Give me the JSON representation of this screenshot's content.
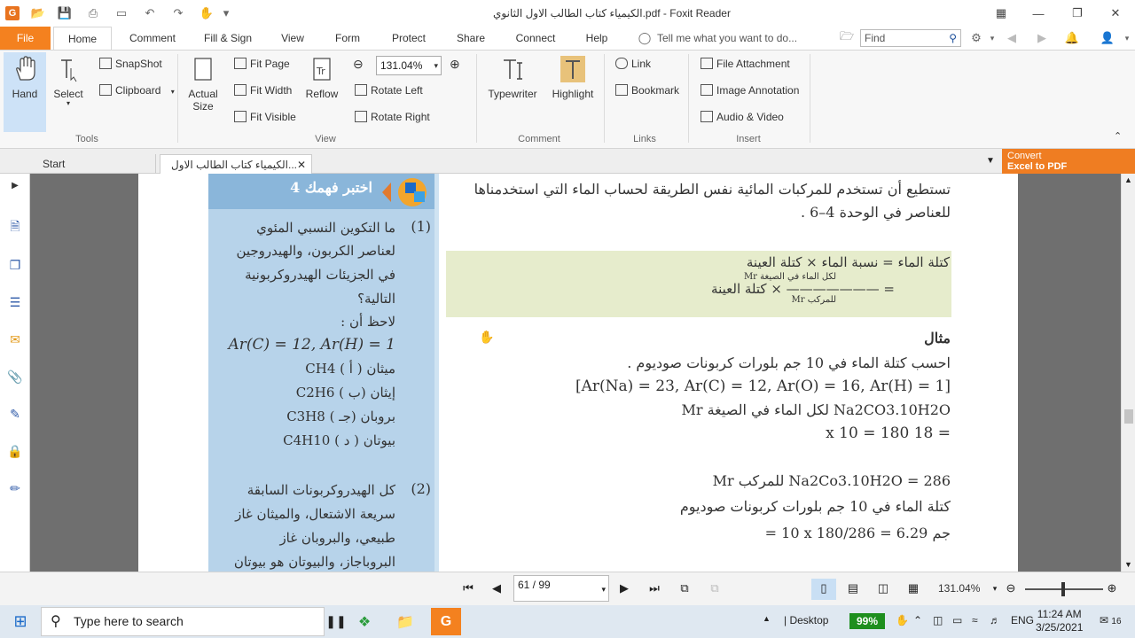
{
  "titlebar": {
    "title": "الكيمياء كتاب الطالب الاول الثانوي.pdf - Foxit Reader"
  },
  "tabs": {
    "file": "File",
    "items": [
      "Home",
      "Comment",
      "Fill & Sign",
      "View",
      "Form",
      "Protect",
      "Share",
      "Connect",
      "Help"
    ],
    "tell_me": "Tell me what you want to do...",
    "find_placeholder": "Find"
  },
  "ribbon": {
    "tools": {
      "hand": "Hand",
      "select": "Select",
      "snapshot": "SnapShot",
      "clipboard": "Clipboard",
      "group": "Tools"
    },
    "view": {
      "actual_size_1": "Actual",
      "actual_size_2": "Size",
      "fit_page": "Fit Page",
      "fit_width": "Fit Width",
      "fit_visible": "Fit Visible",
      "reflow": "Reflow",
      "zoom": "131.04%",
      "rotate_left": "Rotate Left",
      "rotate_right": "Rotate Right",
      "group": "View"
    },
    "comment": {
      "typewriter": "Typewriter",
      "highlight": "Highlight",
      "group": "Comment"
    },
    "links": {
      "link": "Link",
      "bookmark": "Bookmark",
      "group": "Links"
    },
    "insert": {
      "file_attachment": "File Attachment",
      "image_annotation": "Image Annotation",
      "audio_video": "Audio & Video",
      "group": "Insert"
    }
  },
  "doctabs": {
    "start": "Start",
    "document": "الكيمياء كتاب الطالب الاول...",
    "convert_1": "Convert",
    "convert_2": "Excel to PDF"
  },
  "page": {
    "panel_title": "اختبر فهمك 4",
    "q1_num": "(1)",
    "q1_lines": [
      "ما التكوين النسبي المئوي",
      "لعناصر الكربون، والهيدروجين",
      "في الجزيئات الهيدروكربونية",
      "التالية؟",
      "لاحظ أن :"
    ],
    "q1_masses": "Ar(C) = 12, Ar(H) = 1",
    "q1_options": [
      "CH4  ميثان  ( أ )",
      "C2H6  إيثان  (ب )",
      "C3H8  بروبان  (جـ )",
      "C4H10  بيوتان  ( د )"
    ],
    "q2_num": "(2)",
    "q2_lines": [
      "كل الهيدروكربونات السابقة",
      "سريعة الاشتعال، والميثان غاز",
      "طبيعي، والبروبان غاز",
      "البروباجاز، والبيوتان هو بيوتان"
    ],
    "intro_1": "تستطيع أن تستخدم للمركبات المائية نفس الطريقة لحساب الماء التي استخدمناها",
    "intro_2": "للعناصر في الوحدة 4–6 .",
    "formula_1": "كتلة الماء = نسبة الماء × كتلة العينة",
    "formula_num": "Mr لكل الماء في الصيغة",
    "formula_den": "Mr للمركب",
    "formula_2": "= ——————— × كتلة العينة",
    "example_title": "مثال",
    "example_1": "احسب كتلة الماء في 10 جم بلورات كربونات صوديوم .",
    "example_2": "[Ar(Na) = 23, Ar(C) = 12, Ar(O) = 16, Ar(H) = 1]",
    "example_3": "Mr لكل الماء في الصيغة Na2CO3.10H2O",
    "example_4": "= 18 x 10 = 180",
    "example_5": "Mr للمركب Na2Co3.10H2O = 286",
    "example_6": "كتلة الماء في 10 جم بلورات كربونات صوديوم",
    "example_7": "= 10 x 180/286 = 6.29 جم"
  },
  "navbar": {
    "page": "61 / 99",
    "zoom": "131.04%"
  },
  "taskbar": {
    "search_placeholder": "Type here to search",
    "desktop": "Desktop",
    "battery": "99%",
    "lang": "ENG",
    "time": "11:24 AM",
    "date": "3/25/2021",
    "notifications": "16"
  }
}
